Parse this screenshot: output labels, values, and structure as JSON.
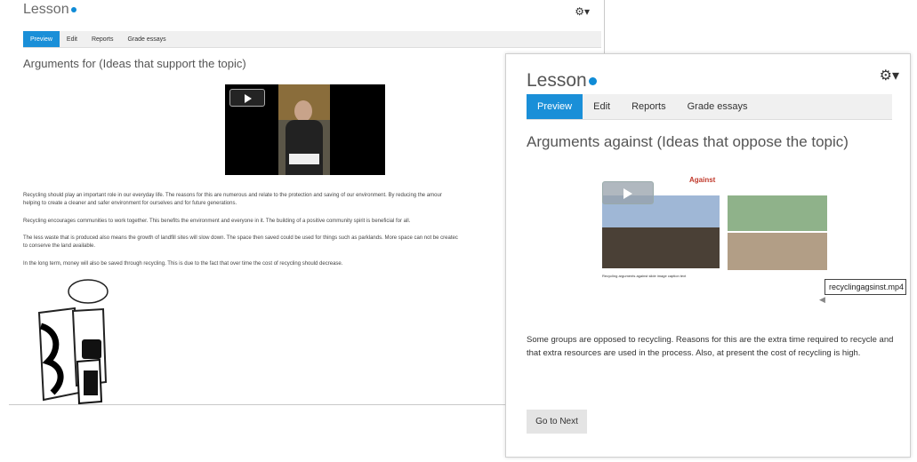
{
  "back_window": {
    "title": "Lesson",
    "tabs": [
      "Preview",
      "Edit",
      "Reports",
      "Grade essays"
    ],
    "subheading": "Arguments for (Ideas that support the topic)",
    "paragraphs": [
      "Recycling should play an important role in our everyday life. The reasons for this are numerous and relate to the protection and saving of our environment. By reducing the amour",
      "helping to create a cleaner and safer environment for ourselves and for future generations.",
      "Recycling encourages communities to work together. This benefits the environment and everyone in it. The building of a positive community spirit is beneficial for all.",
      "The less waste that is produced also means the growth of landfill sites will slow down. The space then saved could be used for things such as parklands. More space can not be createc",
      "to conserve the land available.",
      "In the long term, money will also be saved through recycling. This is due to the fact that over time the cost of recycling should decrease."
    ]
  },
  "front_window": {
    "title": "Lesson",
    "tabs": [
      "Preview",
      "Edit",
      "Reports",
      "Grade essays"
    ],
    "subheading": "Arguments against (Ideas that oppose the topic)",
    "slide_title": "Against",
    "slide_caption": "Recycling arguments against slide image caption text",
    "tooltip": "recyclingagsinst.mp4",
    "body_text": "Some groups are opposed to recycling. Reasons for this are the extra time required to recycle and that extra resources are used in the process. Also, at present the cost of recycling is high.",
    "next_button": "Go to Next"
  },
  "icons": {
    "gear": "gear-icon",
    "help": "help-icon",
    "play": "play-icon",
    "speaker": "speaker-icon"
  },
  "colors": {
    "accent": "#1a8fd8",
    "slide_title": "#c0392b"
  }
}
